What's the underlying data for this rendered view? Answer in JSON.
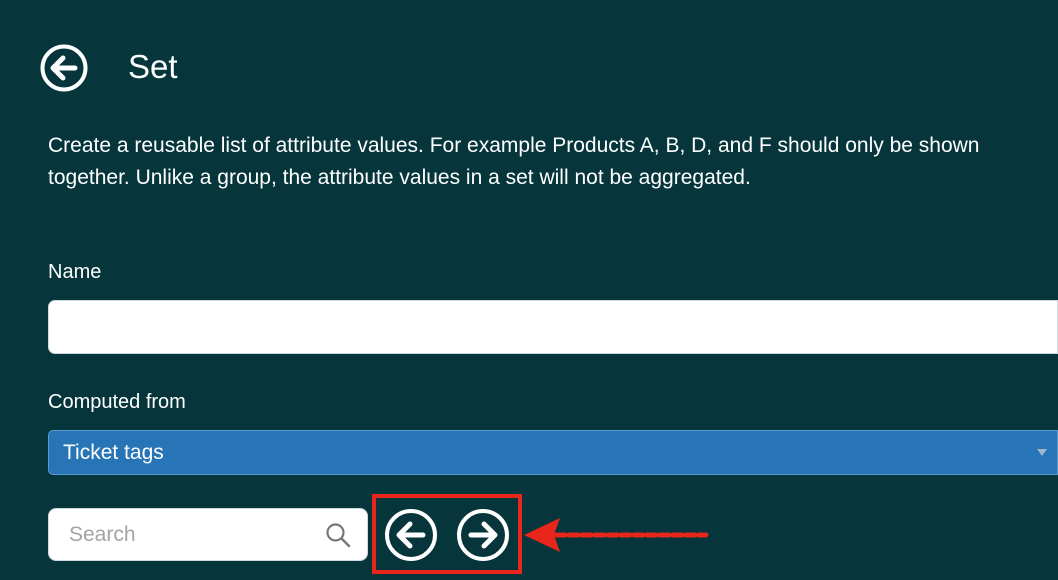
{
  "header": {
    "title": "Set",
    "back_icon": "arrow-left-circle-icon"
  },
  "description": {
    "line1": "Create a reusable list of attribute values. For example Products A, B, D, and F should only be shown",
    "line2": "together. Unlike a group, the attribute values in a set will not be aggregated."
  },
  "form": {
    "name_label": "Name",
    "name_value": "",
    "computed_from_label": "Computed from",
    "computed_from_value": "Ticket tags"
  },
  "search": {
    "placeholder": "Search",
    "icon": "search-icon"
  },
  "navigation": {
    "prev_icon": "arrow-left-circle-icon",
    "next_icon": "arrow-right-circle-icon"
  },
  "annotation": {
    "highlight_color": "#e8261b",
    "arrow_icon": "red-arrow-left-icon"
  },
  "colors": {
    "background": "#06363b",
    "select_background": "#2775b6",
    "text": "#ffffff"
  }
}
